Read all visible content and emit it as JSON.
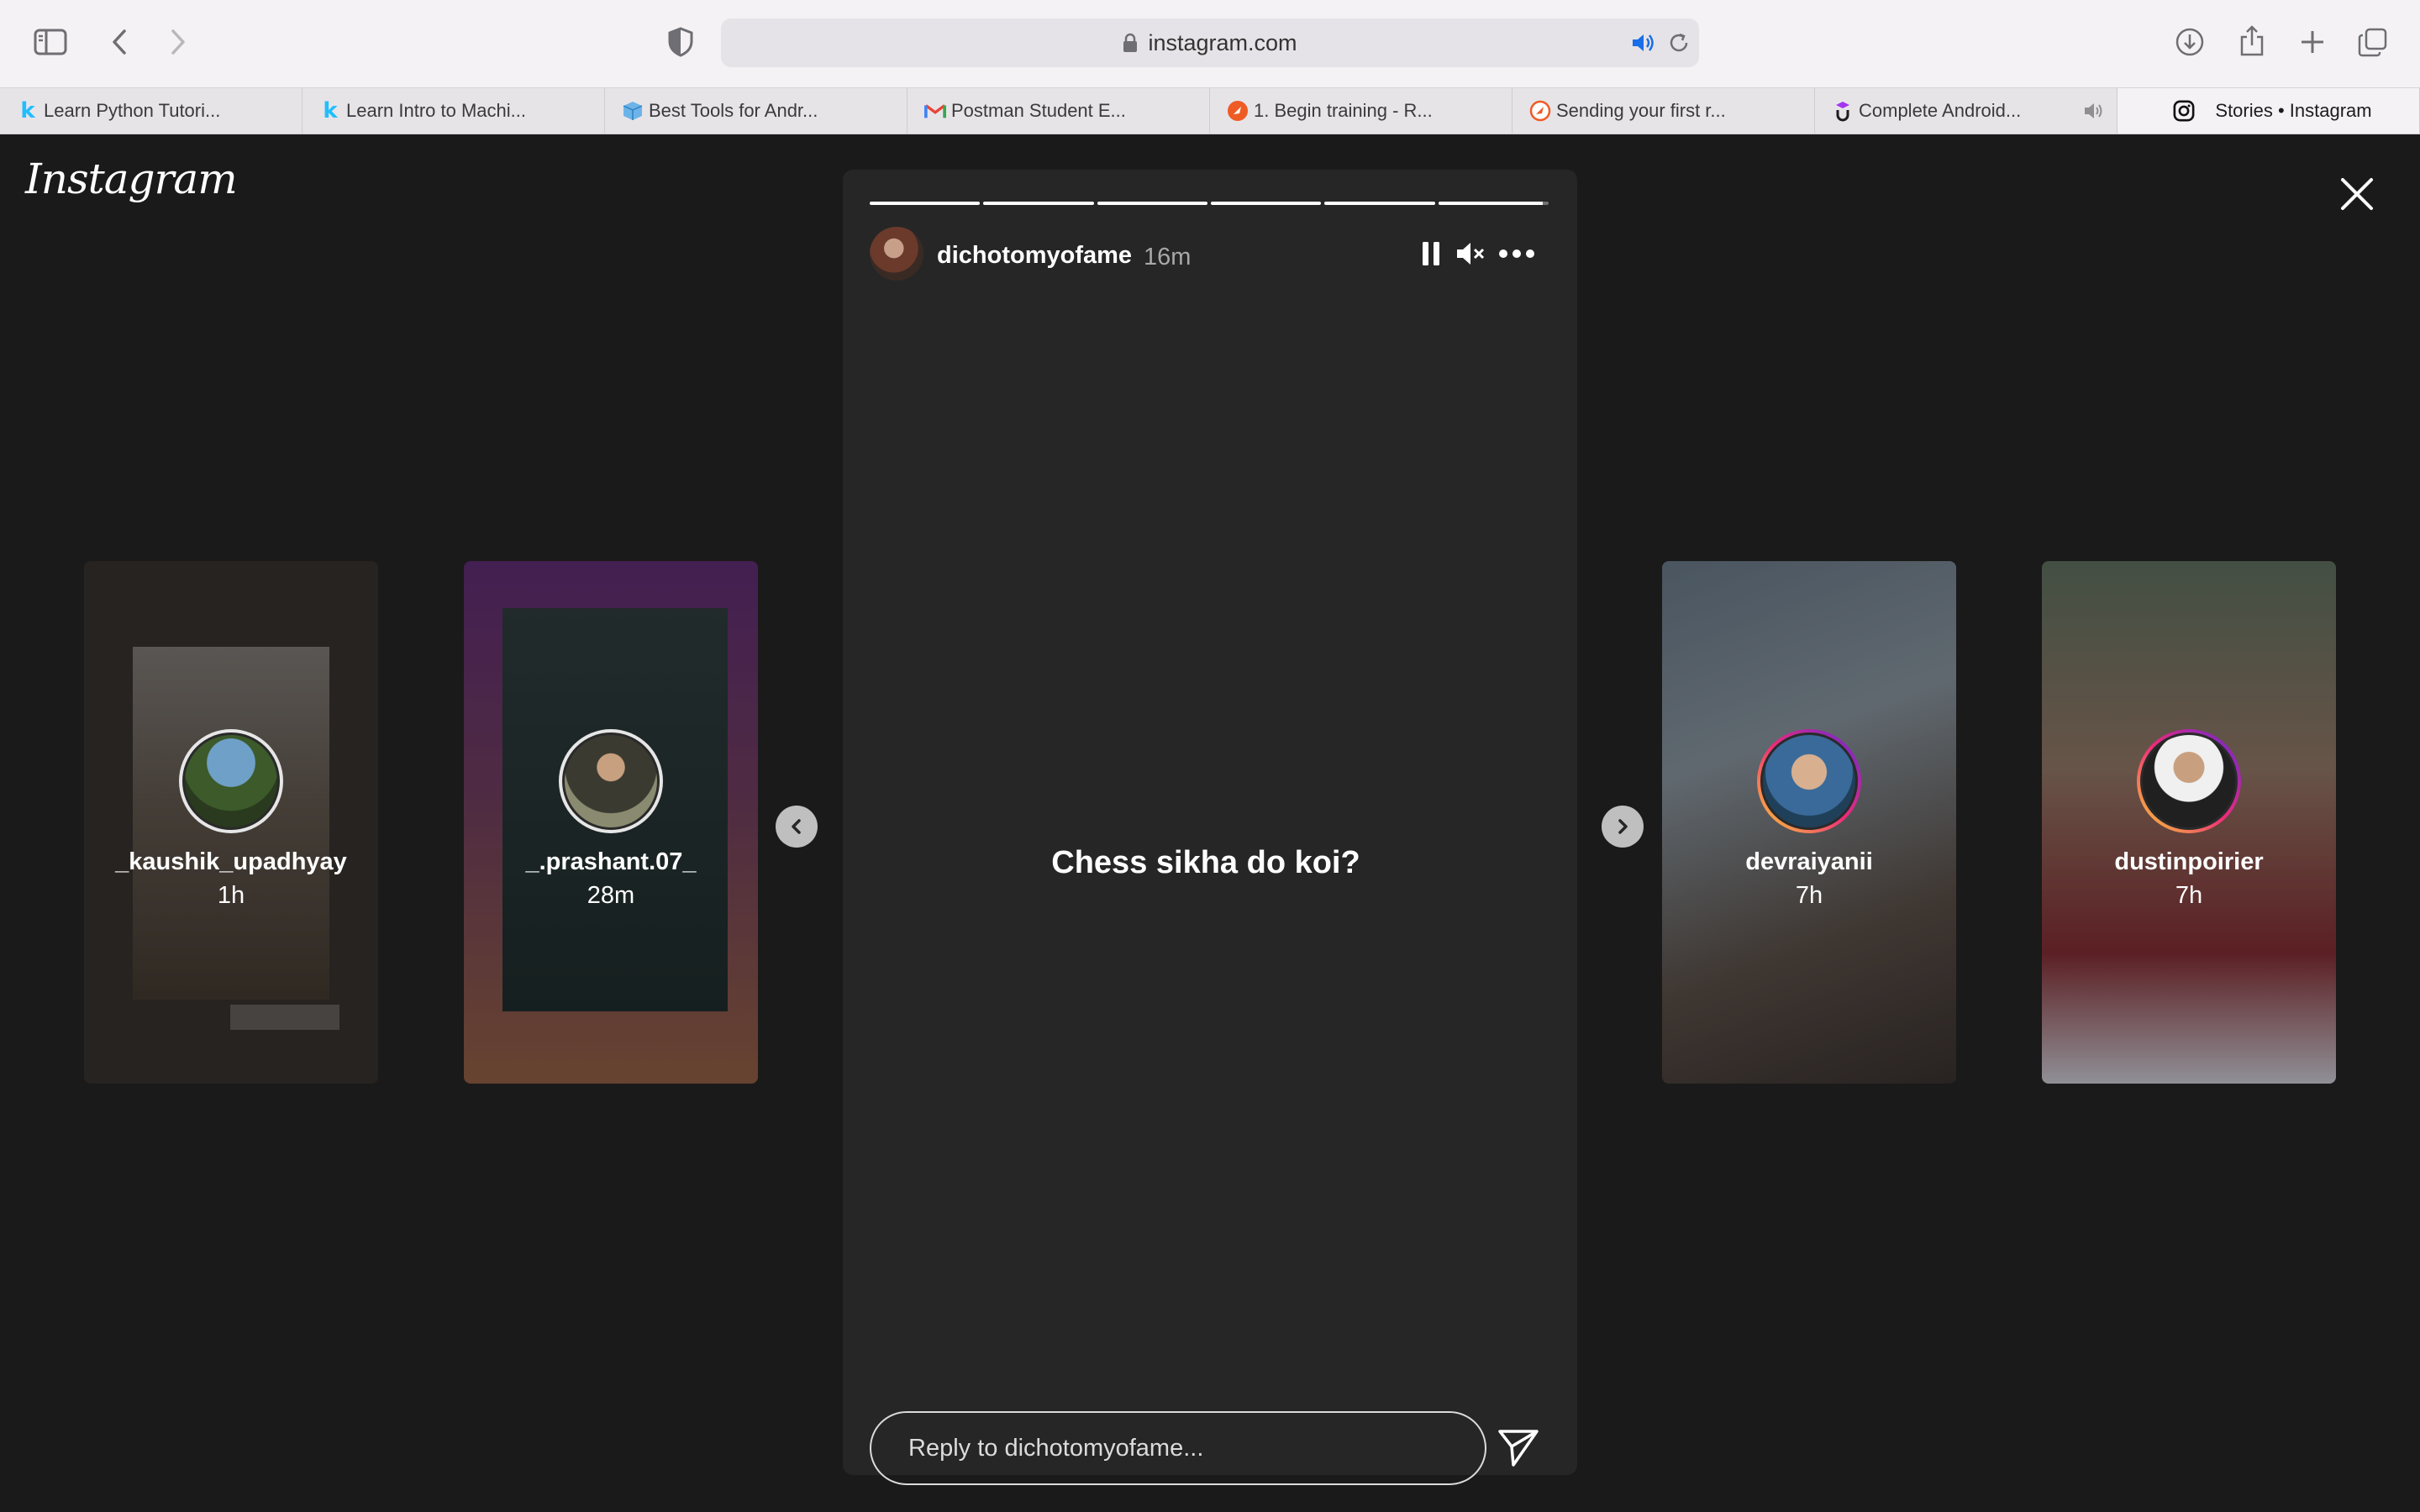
{
  "browser": {
    "url": "instagram.com",
    "tabs": [
      {
        "title": "Learn Python Tutori...",
        "icon": "k"
      },
      {
        "title": "Learn Intro to Machi...",
        "icon": "k"
      },
      {
        "title": "Best Tools for Andr...",
        "icon": "cube"
      },
      {
        "title": "Postman Student E...",
        "icon": "M"
      },
      {
        "title": "1. Begin training - R...",
        "icon": "postman"
      },
      {
        "title": "Sending your first r...",
        "icon": "postman"
      },
      {
        "title": "Complete Android...",
        "icon": "udemy"
      },
      {
        "title": "Stories • Instagram",
        "icon": "instagram",
        "active": true
      }
    ]
  },
  "app": {
    "logo": "Instagram"
  },
  "stories": {
    "left": [
      {
        "username": "_kaushik_upadhyay",
        "time": "1h"
      },
      {
        "username": "_.prashant.07_",
        "time": "28m"
      }
    ],
    "right": [
      {
        "username": "devraiyanii",
        "time": "7h"
      },
      {
        "username": "dustinpoirier",
        "time": "7h"
      }
    ]
  },
  "current_story": {
    "username": "dichotomyofame",
    "time": "16m",
    "text": "Chess sikha do koi?",
    "segments_total": 6,
    "segments_complete": 5,
    "current_segment_progress": 0.95,
    "reply_placeholder": "Reply to dichotomyofame..."
  }
}
